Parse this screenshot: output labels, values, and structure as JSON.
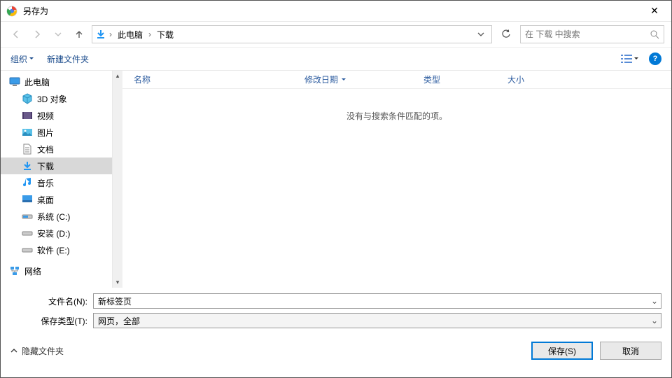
{
  "window": {
    "title": "另存为"
  },
  "path": {
    "root": "此电脑",
    "current": "下载"
  },
  "search": {
    "placeholder": "在 下载 中搜索"
  },
  "toolbar": {
    "organize": "组织",
    "newfolder": "新建文件夹"
  },
  "columns": {
    "name": "名称",
    "date": "修改日期",
    "type": "类型",
    "size": "大小"
  },
  "empty_text": "没有与搜索条件匹配的项。",
  "tree": {
    "root": "此电脑",
    "items": [
      {
        "label": "3D 对象"
      },
      {
        "label": "视频"
      },
      {
        "label": "图片"
      },
      {
        "label": "文档"
      },
      {
        "label": "下载",
        "selected": true
      },
      {
        "label": "音乐"
      },
      {
        "label": "桌面"
      },
      {
        "label": "系统 (C:)"
      },
      {
        "label": "安装 (D:)"
      },
      {
        "label": "软件 (E:)"
      }
    ],
    "network": "网络"
  },
  "form": {
    "filename_label": "文件名(N):",
    "filename_value": "新标签页",
    "type_label": "保存类型(T):",
    "type_value": "网页，全部"
  },
  "footer": {
    "hide": "隐藏文件夹",
    "save": "保存(S)",
    "cancel": "取消"
  }
}
